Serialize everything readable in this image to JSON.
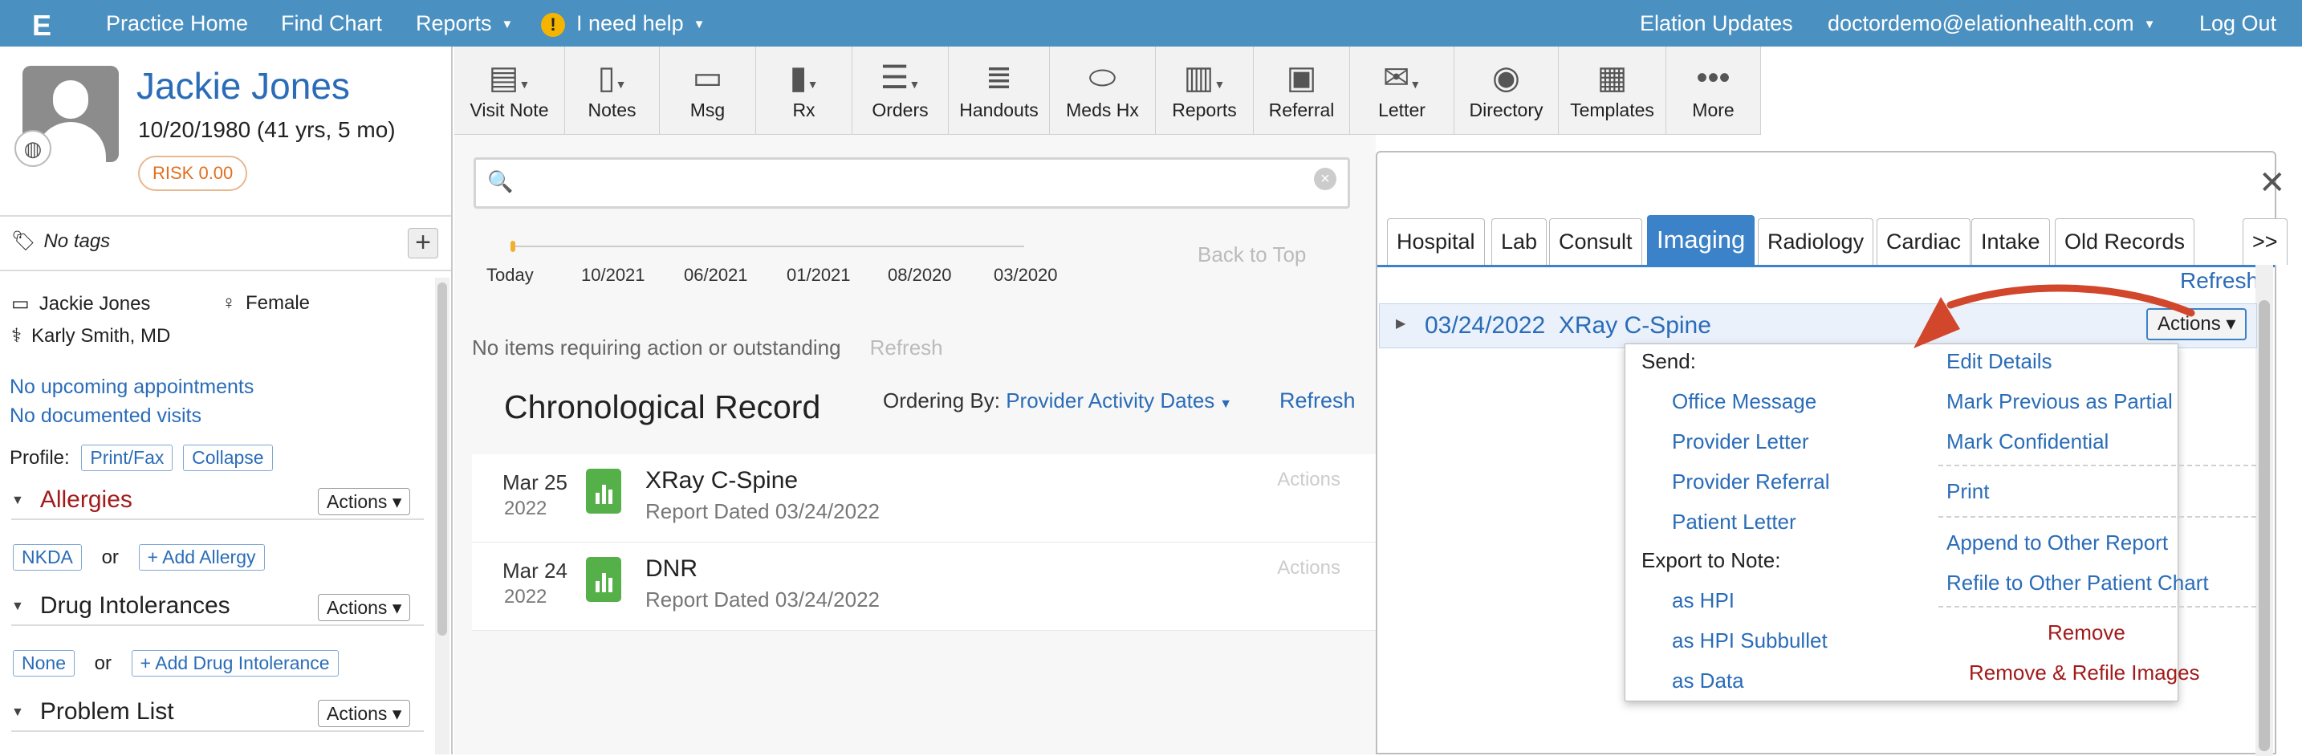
{
  "topbar": {
    "nav": [
      "Practice Home",
      "Find Chart",
      "Reports",
      "I need help"
    ],
    "right": [
      "Elation Updates",
      "doctordemo@elationhealth.com",
      "Log Out"
    ]
  },
  "patient": {
    "name": "Jackie Jones",
    "dob": "10/20/1980 (41 yrs, 5 mo)",
    "risk": "RISK 0.00",
    "tags": "No tags",
    "full_name": "Jackie Jones",
    "sex": "Female",
    "provider": "Karly Smith, MD",
    "appointments": "No upcoming appointments",
    "visits": "No documented visits",
    "profile_label": "Profile:",
    "print_fax": "Print/Fax",
    "collapse": "Collapse"
  },
  "sections": {
    "allergies": "Allergies",
    "drug": "Drug Intolerances",
    "problems": "Problem List",
    "actions": "Actions",
    "nkda": "NKDA",
    "or": "or",
    "add_allergy": "+ Add Allergy",
    "none": "None",
    "add_drug": "+ Add Drug Intolerance"
  },
  "toolbar": [
    "Visit Note",
    "Notes",
    "Msg",
    "Rx",
    "Orders",
    "Handouts",
    "Meds Hx",
    "Reports",
    "Referral",
    "Letter",
    "Directory",
    "Templates",
    "More"
  ],
  "timeline": {
    "labels": [
      "Today",
      "10/2021",
      "06/2021",
      "01/2021",
      "08/2020",
      "03/2020"
    ],
    "back_to_top": "Back to Top"
  },
  "record": {
    "no_items": "No items requiring action or outstanding",
    "refresh": "Refresh",
    "title": "Chronological Record",
    "ordering_label": "Ordering By:",
    "ordering_value": "Provider Activity Dates",
    "refresh2": "Refresh",
    "items": [
      {
        "date": "Mar 25",
        "year": "2022",
        "title": "XRay C-Spine",
        "sub": "Report Dated 03/24/2022",
        "actions": "Actions"
      },
      {
        "date": "Mar 24",
        "year": "2022",
        "title": "DNR",
        "sub": "Report Dated 03/24/2022",
        "actions": "Actions"
      }
    ]
  },
  "panel": {
    "tabs": [
      "Hospital",
      "Lab",
      "Consult",
      "Imaging",
      "Radiology",
      "Cardiac",
      "Intake",
      "Old Records",
      ">>"
    ],
    "refresh": "Refresh",
    "row_date": "03/24/2022",
    "row_title": "XRay C-Spine",
    "actions": "Actions"
  },
  "menu": {
    "send": "Send:",
    "send_items": [
      "Office Message",
      "Provider Letter",
      "Provider Referral",
      "Patient Letter"
    ],
    "export": "Export to Note:",
    "export_items": [
      "as HPI",
      "as HPI Subbullet",
      "as Data"
    ],
    "edit": "Edit Details",
    "mark_partial": "Mark Previous as Partial",
    "mark_conf": "Mark Confidential",
    "print": "Print",
    "append": "Append to Other Report",
    "refile": "Refile to Other Patient Chart",
    "remove": "Remove",
    "remove_refile": "Remove & Refile Images"
  },
  "colors": {
    "brand": "#4a90c0",
    "link": "#2a6cb8",
    "tab_active": "#3b82c8",
    "danger": "#a21b1b",
    "arrow": "#d2462b",
    "report_icon": "#55b04a"
  }
}
